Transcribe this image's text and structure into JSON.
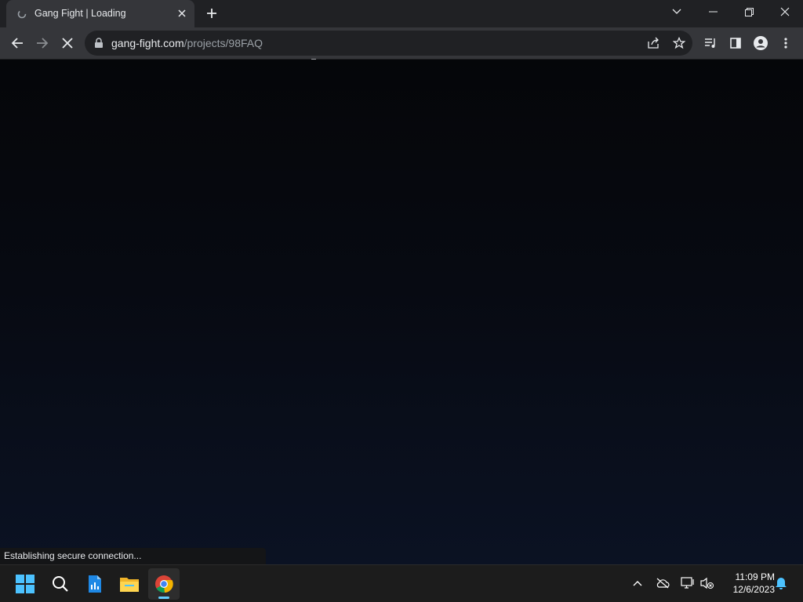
{
  "browser": {
    "tab": {
      "title": "Gang Fight | Loading",
      "favicon": "loading-favicon-icon",
      "close_icon": "close-icon"
    },
    "new_tab_icon": "plus-icon",
    "window_controls": [
      "tab-search-icon",
      "minimize-icon",
      "restore-icon",
      "close-icon"
    ],
    "toolbar": {
      "back_icon": "arrow-left-icon",
      "forward_icon": "arrow-right-icon",
      "stop_icon": "stop-loading-icon",
      "url_host": "gang-fight.com",
      "url_path": "/projects/98FAQ",
      "share_icon": "share-icon",
      "bookmark_icon": "star-icon",
      "media_icon": "media-queue-icon",
      "side_panel_icon": "side-panel-icon",
      "profile_icon": "profile-icon",
      "menu_icon": "more-vert-icon"
    },
    "status_text": "Establishing secure connection..."
  },
  "taskbar": {
    "apps": [
      {
        "name": "windows-start-icon"
      },
      {
        "name": "search-icon"
      },
      {
        "name": "docs-app-icon"
      },
      {
        "name": "file-explorer-icon"
      },
      {
        "name": "chrome-icon",
        "active": true
      }
    ],
    "tray": [
      "chevron-up-icon",
      "cloud-offline-icon",
      "network-icon",
      "volume-muted-icon"
    ],
    "time": "11:09 PM",
    "date": "12/6/2023",
    "notification_icon": "bell-icon"
  },
  "colors": {
    "accent": "#60cdff",
    "tab_active": "#35363a",
    "chrome_frame": "#202124"
  }
}
